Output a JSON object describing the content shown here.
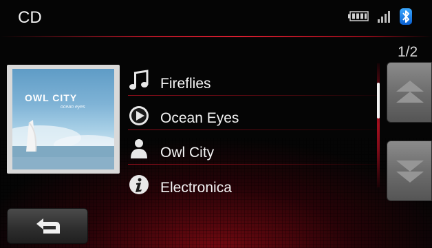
{
  "header": {
    "title": "CD"
  },
  "status": {
    "battery": "battery-icon",
    "signal": "signal-bars-icon",
    "bluetooth": "bluetooth-icon"
  },
  "pagination": {
    "indicator": "1/2"
  },
  "album": {
    "artist_text": "OWL CITY",
    "subtitle_text": "ocean eyes"
  },
  "track_info": [
    {
      "icon": "music-note-icon",
      "label": "Fireflies"
    },
    {
      "icon": "play-circle-icon",
      "label": "Ocean Eyes"
    },
    {
      "icon": "person-icon",
      "label": "Owl City"
    },
    {
      "icon": "info-icon",
      "label": "Electronica"
    }
  ],
  "controls": {
    "scroll_up": "double-chevron-up-icon",
    "scroll_down": "double-chevron-down-icon",
    "back": "return-arrow-icon"
  },
  "colors": {
    "accent": "#c8162a",
    "background": "#050505"
  }
}
